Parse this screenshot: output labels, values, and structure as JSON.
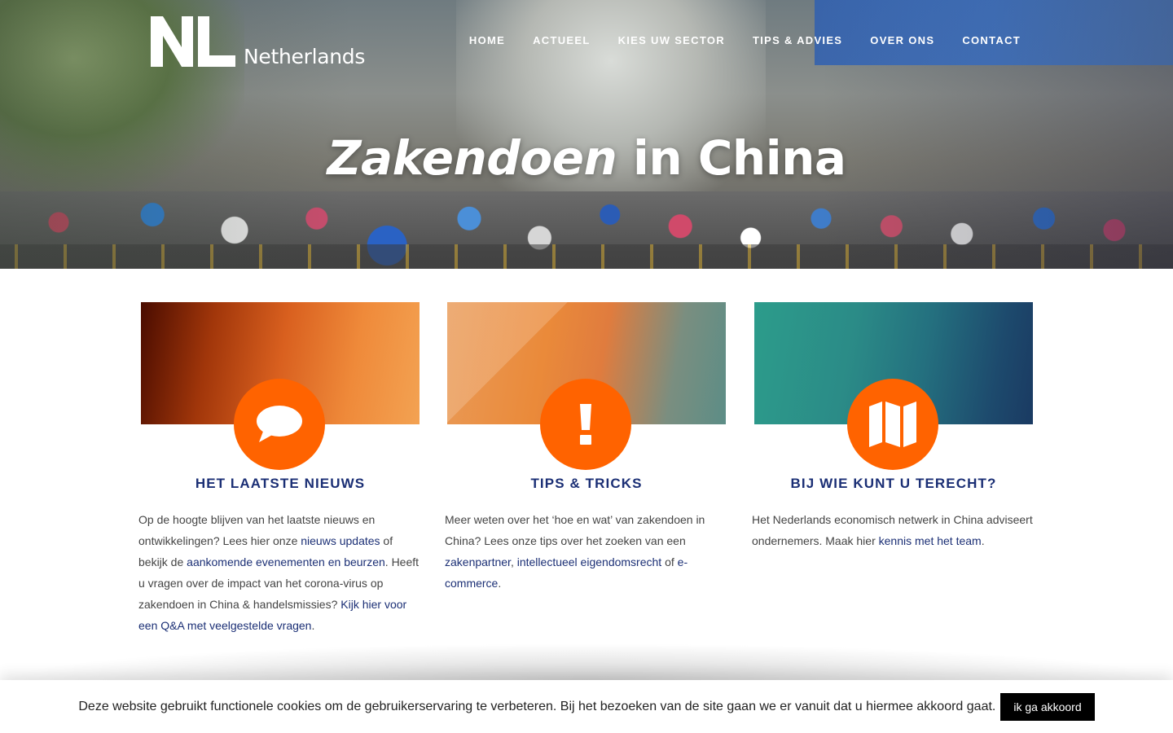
{
  "brand": {
    "mark": "NL",
    "name": "Netherlands"
  },
  "nav": {
    "items": [
      {
        "label": "HOME"
      },
      {
        "label": "ACTUEEL"
      },
      {
        "label": "KIES UW SECTOR"
      },
      {
        "label": "TIPS & ADVIES"
      },
      {
        "label": "OVER ONS"
      },
      {
        "label": "CONTACT"
      }
    ]
  },
  "hero": {
    "title_em": "Zakendoen",
    "title_rest": "in China"
  },
  "cards": [
    {
      "icon": "speech-bubble-icon",
      "title": "HET LAATSTE NIEUWS",
      "text": {
        "t1": "Op de hoogte blijven van het laatste nieuws en ontwikkelingen? Lees hier onze ",
        "link1": "nieuws updates",
        "t2": " of bekijk de ",
        "link2": "aankomende evenementen en beurzen",
        "t3": ". Heeft u vragen over de impact van het corona-virus op zakendoen in China & handelsmissies? ",
        "link3": "Kijk hier voor een Q&A met veelgestelde vragen",
        "t4": "."
      }
    },
    {
      "icon": "exclamation-icon",
      "title": "TIPS & TRICKS",
      "text": {
        "t1": "Meer weten over het ‘hoe en wat’ van zakendoen in China? Lees onze tips over het zoeken van een ",
        "link1": "zakenpartner",
        "t2": ", ",
        "link2": "intellectueel eigendomsrecht",
        "t3": " of ",
        "link3": "e-commerce",
        "t4": "."
      }
    },
    {
      "icon": "map-icon",
      "title": "BIJ WIE KUNT U TERECHT?",
      "text": {
        "t1": "Het Nederlands economisch netwerk in China adviseert ondernemers. Maak hier ",
        "link1": "kennis met het team",
        "t2": "."
      }
    }
  ],
  "cookie": {
    "message": "Deze website gebruikt functionele cookies om de gebruikerservaring te verbeteren. Bij het bezoeken van de site gaan we er vanuit dat u hiermee akkoord gaat.",
    "button": "ik ga akkoord"
  },
  "colors": {
    "accent": "#ff6300",
    "heading": "#1b2f75",
    "link": "#1b2f75"
  }
}
